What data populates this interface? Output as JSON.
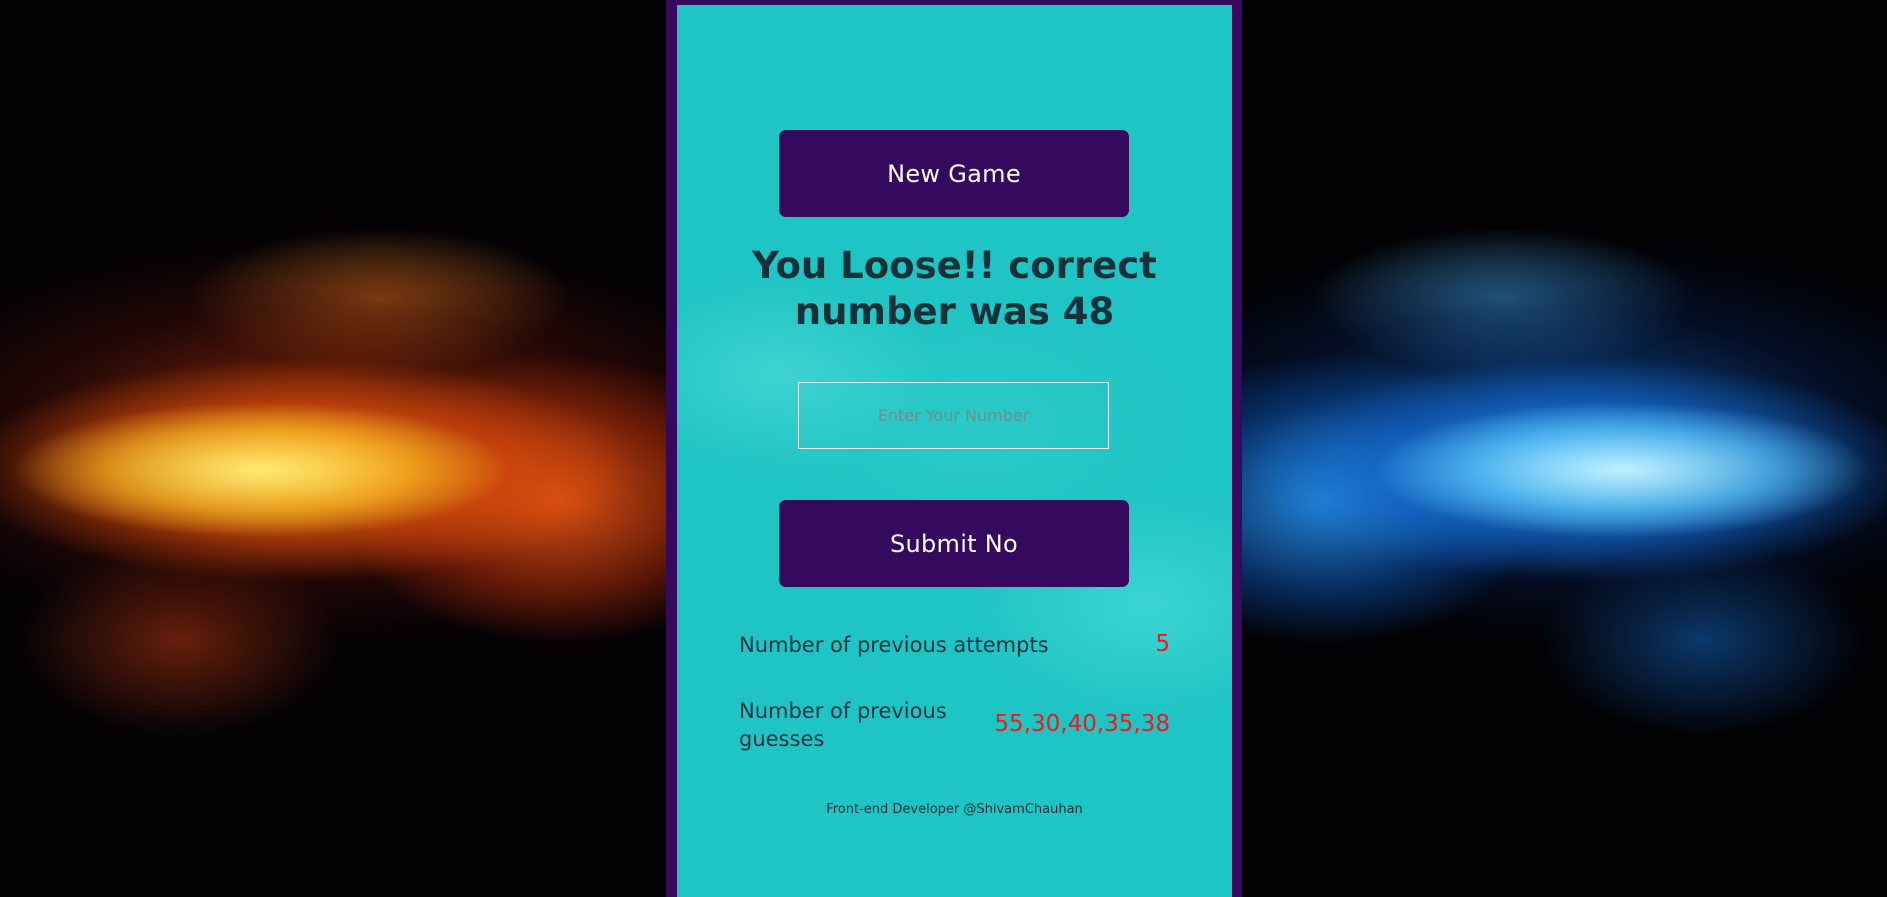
{
  "game": {
    "new_game_label": "New Game",
    "message_line1": "You Loose!! correct",
    "message_line2": "number was 48",
    "input_placeholder": "Enter Your Number",
    "input_value": "",
    "submit_label": "Submit No",
    "attempts_label": "Number of previous attempts",
    "attempts_value": "5",
    "guesses_label": "Number of previous guesses",
    "guesses_value": "55,30,40,35,38",
    "footer": "Front-end Developer @ShivamChauhan"
  },
  "colors": {
    "panel_background": "#1fc4c4",
    "button_background": "#34095e",
    "value_text": "#f01a1a",
    "primary_text": "#17313a"
  },
  "background": {
    "left_theme": "fire",
    "right_theme": "ice"
  }
}
